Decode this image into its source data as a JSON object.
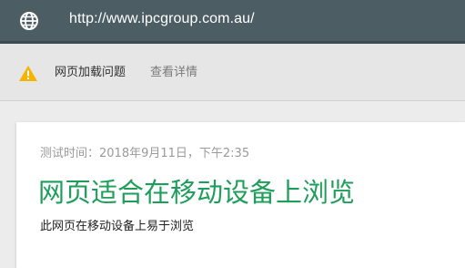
{
  "address_bar": {
    "icon": "globe-icon",
    "url": "http://www.ipcgroup.com.au/"
  },
  "warning_bar": {
    "icon": "warning-icon",
    "label": "网页加载问题",
    "details_link": "查看详情",
    "icon_color": "#f5b400"
  },
  "result_card": {
    "test_time": "测试时间：2018年9月11日，下午2:35",
    "title": "网页适合在移动设备上浏览",
    "description": "此网页在移动设备上易于浏览",
    "title_color": "#1e9e5a"
  }
}
